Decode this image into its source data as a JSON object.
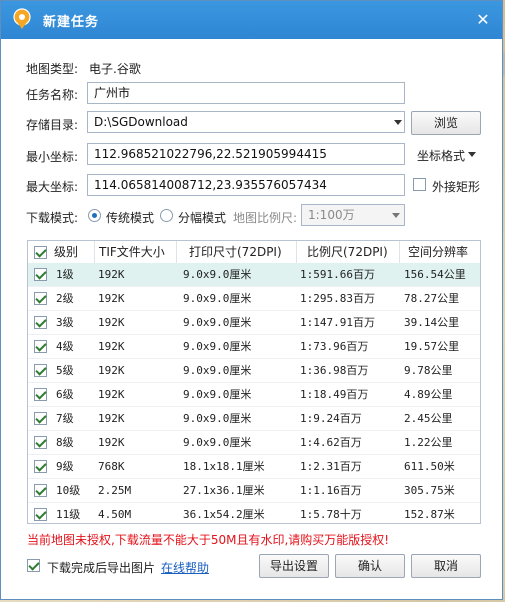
{
  "window": {
    "title": "新建任务",
    "close_label": "✕"
  },
  "form": {
    "map_type_label": "地图类型:",
    "map_type_value": "电子.谷歌",
    "task_name_label": "任务名称:",
    "task_name_value": "广州市",
    "storage_label": "存储目录:",
    "storage_value": "D:\\SGDownload",
    "browse_label": "浏览",
    "min_coord_label": "最小坐标:",
    "min_coord_value": "112.968521022796,22.521905994415",
    "coord_format_label": "坐标格式",
    "max_coord_label": "最大坐标:",
    "max_coord_value": "114.065814008712,23.935576057434",
    "outer_rect_label": "外接矩形",
    "outer_rect_checked": false,
    "download_mode_label": "下载模式:",
    "mode_traditional": "传统模式",
    "mode_tiled": "分幅模式",
    "selected_mode": "传统模式",
    "scale_label": "地图比例尺:",
    "scale_value": "1:100万"
  },
  "table": {
    "headers": [
      "级别",
      "TIF文件大小",
      "打印尺寸(72DPI)",
      "比例尺(72DPI)",
      "空间分辨率"
    ],
    "header_checked": true,
    "rows": [
      {
        "checked": true,
        "level": "1级",
        "size": "192K",
        "print": "9.0x9.0厘米",
        "scale": "1:591.66百万",
        "res": "156.54公里",
        "selected": true
      },
      {
        "checked": true,
        "level": "2级",
        "size": "192K",
        "print": "9.0x9.0厘米",
        "scale": "1:295.83百万",
        "res": "78.27公里",
        "selected": false
      },
      {
        "checked": true,
        "level": "3级",
        "size": "192K",
        "print": "9.0x9.0厘米",
        "scale": "1:147.91百万",
        "res": "39.14公里",
        "selected": false
      },
      {
        "checked": true,
        "level": "4级",
        "size": "192K",
        "print": "9.0x9.0厘米",
        "scale": "1:73.96百万",
        "res": "19.57公里",
        "selected": false
      },
      {
        "checked": true,
        "level": "5级",
        "size": "192K",
        "print": "9.0x9.0厘米",
        "scale": "1:36.98百万",
        "res": "9.78公里",
        "selected": false
      },
      {
        "checked": true,
        "level": "6级",
        "size": "192K",
        "print": "9.0x9.0厘米",
        "scale": "1:18.49百万",
        "res": "4.89公里",
        "selected": false
      },
      {
        "checked": true,
        "level": "7级",
        "size": "192K",
        "print": "9.0x9.0厘米",
        "scale": "1:9.24百万",
        "res": "2.45公里",
        "selected": false
      },
      {
        "checked": true,
        "level": "8级",
        "size": "192K",
        "print": "9.0x9.0厘米",
        "scale": "1:4.62百万",
        "res": "1.22公里",
        "selected": false
      },
      {
        "checked": true,
        "level": "9级",
        "size": "768K",
        "print": "18.1x18.1厘米",
        "scale": "1:2.31百万",
        "res": "611.50米",
        "selected": false
      },
      {
        "checked": true,
        "level": "10级",
        "size": "2.25M",
        "print": "27.1x36.1厘米",
        "scale": "1:1.16百万",
        "res": "305.75米",
        "selected": false
      },
      {
        "checked": true,
        "level": "11级",
        "size": "4.50M",
        "print": "36.1x54.2厘米",
        "scale": "1:5.78十万",
        "res": "152.87米",
        "selected": false
      }
    ]
  },
  "warning": "当前地图未授权,下载流量不能大于50M且有水印,请购买万能版授权!",
  "footer": {
    "export_after_label": "下载完成后导出图片",
    "export_after_checked": true,
    "online_help": "在线帮助",
    "export_settings": "导出设置",
    "confirm": "确认",
    "cancel": "取消"
  },
  "colors": {
    "titlebar": "#2f86d3",
    "warning": "#e3121b",
    "link": "#1a5fc0",
    "selected_row": "#dff2f0"
  }
}
